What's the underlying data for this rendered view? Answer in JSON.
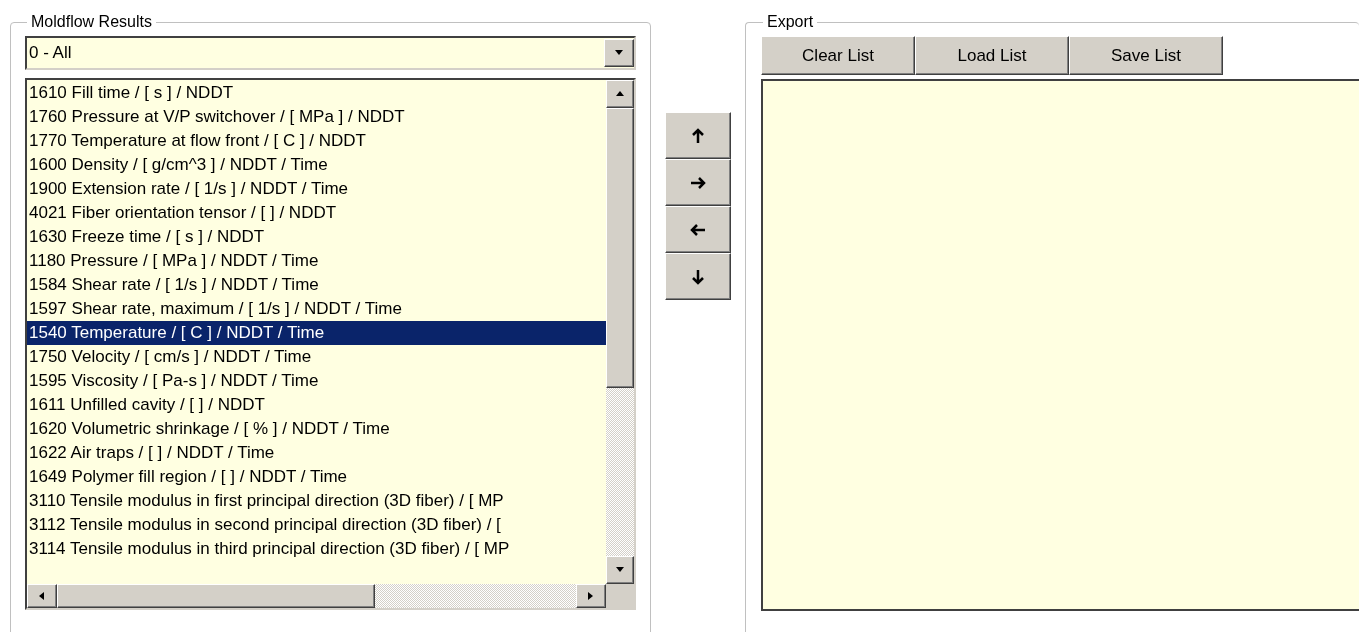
{
  "results_group": {
    "title": "Moldflow Results",
    "filter": {
      "value": "0 - All"
    },
    "items": [
      {
        "label": "1610 Fill time / [ s ] / NDDT",
        "selected": false
      },
      {
        "label": "1760 Pressure at V/P switchover / [ MPa ] / NDDT",
        "selected": false
      },
      {
        "label": "1770 Temperature at flow front / [ C ] / NDDT",
        "selected": false
      },
      {
        "label": "1600 Density / [ g/cm^3 ] / NDDT / Time",
        "selected": false
      },
      {
        "label": "1900 Extension rate / [ 1/s ] / NDDT / Time",
        "selected": false
      },
      {
        "label": "4021 Fiber orientation tensor / [  ] / NDDT",
        "selected": false
      },
      {
        "label": "1630 Freeze time / [ s ] / NDDT",
        "selected": false
      },
      {
        "label": "1180 Pressure / [ MPa ] / NDDT / Time",
        "selected": false
      },
      {
        "label": "1584 Shear rate / [ 1/s ] / NDDT / Time",
        "selected": false
      },
      {
        "label": "1597 Shear rate, maximum / [ 1/s ] / NDDT / Time",
        "selected": false
      },
      {
        "label": "1540 Temperature / [ C ] / NDDT / Time",
        "selected": true
      },
      {
        "label": "1750 Velocity / [ cm/s ] / NDDT / Time",
        "selected": false
      },
      {
        "label": "1595 Viscosity / [ Pa-s ] / NDDT / Time",
        "selected": false
      },
      {
        "label": "1611 Unfilled cavity / [  ] / NDDT",
        "selected": false
      },
      {
        "label": "1620 Volumetric shrinkage / [ % ] / NDDT / Time",
        "selected": false
      },
      {
        "label": "1622 Air traps / [  ] / NDDT / Time",
        "selected": false
      },
      {
        "label": "1649 Polymer fill region / [  ] / NDDT / Time",
        "selected": false
      },
      {
        "label": "3110 Tensile modulus in first principal direction (3D fiber) / [ MP",
        "selected": false
      },
      {
        "label": "3112 Tensile modulus in second principal direction (3D fiber) / [",
        "selected": false
      },
      {
        "label": "3114 Tensile modulus in third principal direction (3D fiber) / [ MP",
        "selected": false
      }
    ]
  },
  "move_buttons": [
    {
      "kind": "up"
    },
    {
      "kind": "right"
    },
    {
      "kind": "left"
    },
    {
      "kind": "down"
    }
  ],
  "export_group": {
    "title": "Export",
    "buttons": [
      "Clear List",
      "Load List",
      "Save List"
    ]
  }
}
